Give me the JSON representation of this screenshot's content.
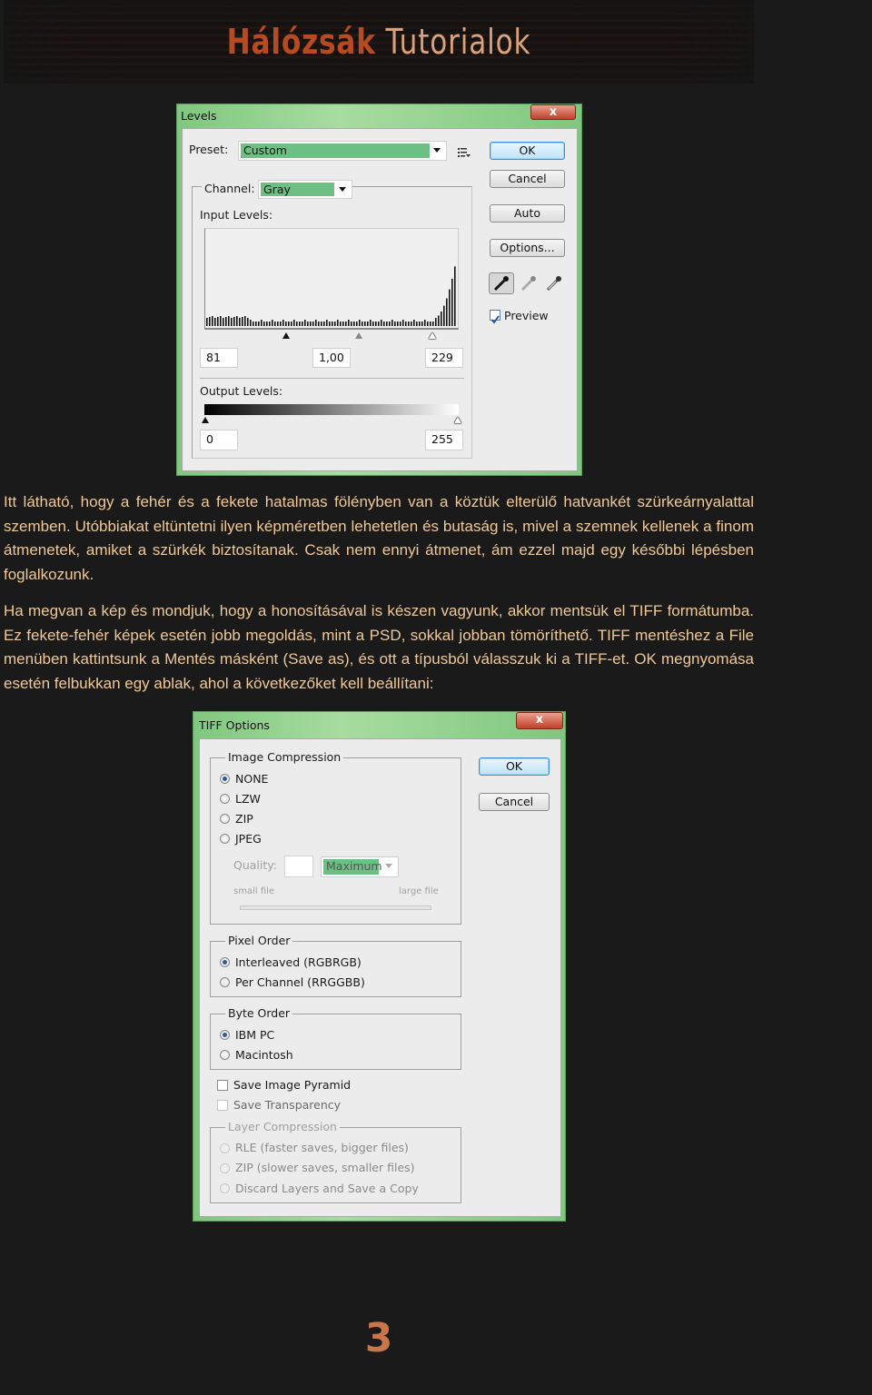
{
  "banner": {
    "title_part1": "Hálózsák",
    "title_part2": "Tutorialok"
  },
  "levels_dialog": {
    "title": "Levels",
    "close_label": "x",
    "preset_label": "Preset:",
    "preset_value": "Custom",
    "channel_label": "Channel:",
    "channel_value": "Gray",
    "input_levels_label": "Input Levels:",
    "input_black": "81",
    "input_gamma": "1,00",
    "input_white": "229",
    "output_levels_label": "Output Levels:",
    "output_black": "0",
    "output_white": "255",
    "buttons": {
      "ok": "OK",
      "cancel": "Cancel",
      "auto": "Auto",
      "options": "Options..."
    },
    "preview_label": "Preview",
    "preview_checked": true,
    "icons": [
      "preset-menu-icon",
      "black-eyedropper-icon",
      "gray-eyedropper-icon",
      "white-eyedropper-icon"
    ]
  },
  "paragraphs": [
    "Itt látható, hogy a fehér és a fekete hatalmas fölényben van a köztük elterülő hatvankét szürkeárnyalattal szemben. Utóbbiakat eltüntetni ilyen képméretben lehetetlen és butaság is, mivel a szemnek kellenek a finom átmenetek, amiket a szürkék biztosítanak. Csak nem ennyi átmenet, ám ezzel majd egy későbbi lépésben foglalkozunk.",
    "Ha megvan a kép és mondjuk, hogy a honosításával is készen vagyunk, akkor mentsük el TIFF formátumba. Ez fekete-fehér képek esetén jobb megoldás, mint a PSD, sokkal jobban tömöríthető. TIFF mentéshez a File menüben kattintsunk a Mentés másként (Save as), és ott a típusból válasszuk ki a TIFF-et. OK megnyomása esetén felbukkan egy ablak, ahol a következőket kell beállítani:"
  ],
  "tiff_dialog": {
    "title": "TIFF Options",
    "close_label": "x",
    "buttons": {
      "ok": "OK",
      "cancel": "Cancel"
    },
    "image_compression": {
      "label": "Image Compression",
      "options": [
        "NONE",
        "LZW",
        "ZIP",
        "JPEG"
      ],
      "selected": "NONE",
      "quality_label": "Quality:",
      "quality_value": "",
      "quality_preset": "Maximum",
      "small_file": "small file",
      "large_file": "large file"
    },
    "pixel_order": {
      "label": "Pixel Order",
      "options": [
        "Interleaved (RGBRGB)",
        "Per Channel (RRGGBB)"
      ],
      "selected": "Interleaved (RGBRGB)"
    },
    "byte_order": {
      "label": "Byte Order",
      "options": [
        "IBM PC",
        "Macintosh"
      ],
      "selected": "IBM PC"
    },
    "save_image_pyramid": "Save Image Pyramid",
    "save_transparency": "Save Transparency",
    "layer_compression": {
      "label": "Layer Compression",
      "options": [
        "RLE (faster saves, bigger files)",
        "ZIP (slower saves, smaller files)",
        "Discard Layers and Save a Copy"
      ]
    }
  },
  "page_number": "3",
  "colors": {
    "background": "#1a1a1a",
    "text": "#f0c898",
    "accent": "#b84a22",
    "dialog_green": "#7fc77f",
    "select_green": "#6dbf84"
  }
}
